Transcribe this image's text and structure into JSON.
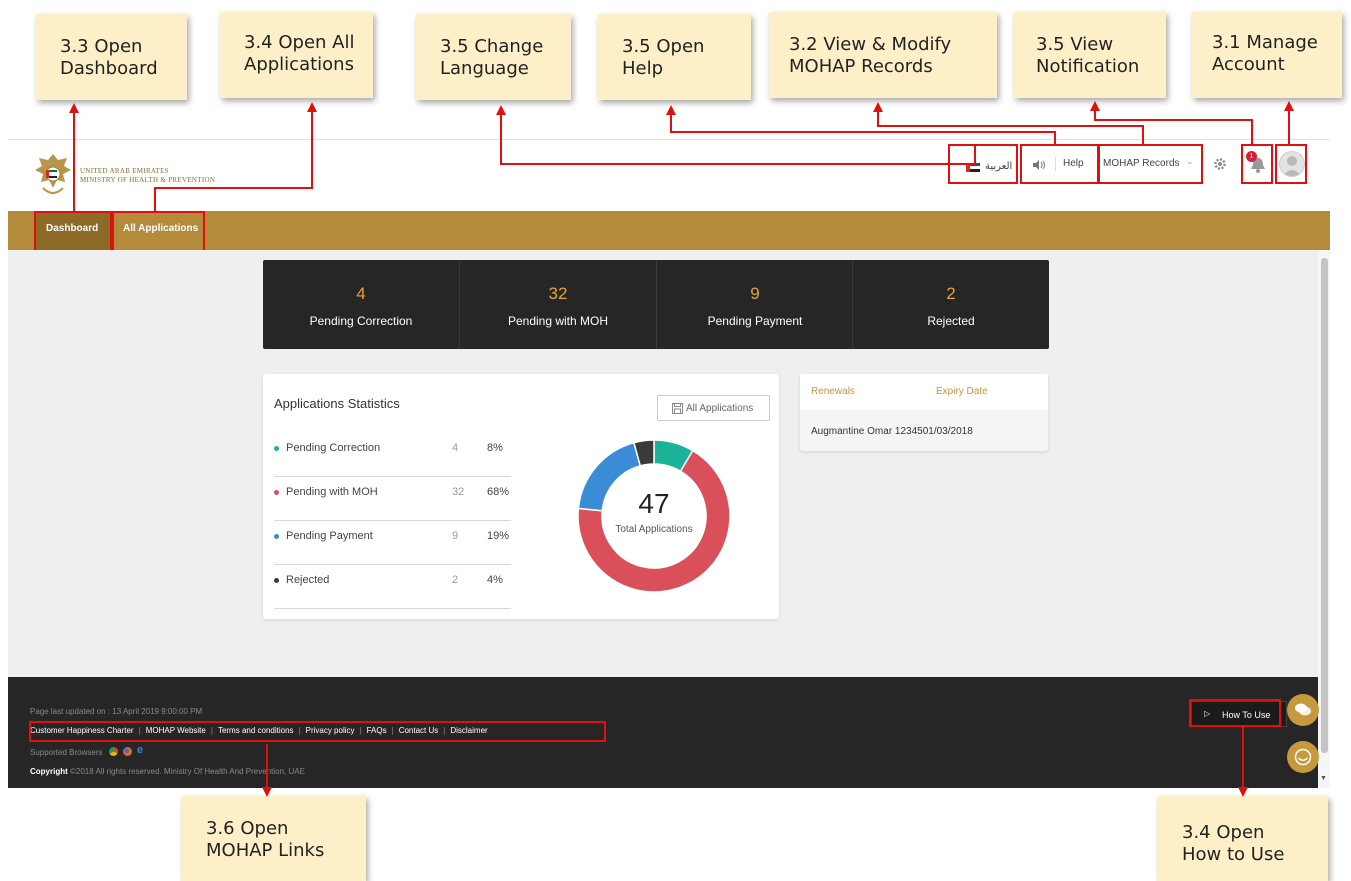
{
  "callouts": [
    {
      "line1": "3.3 Open",
      "line2": "Dashboard"
    },
    {
      "line1": "3.4 Open All",
      "line2": "Applications"
    },
    {
      "line1": "3.5 Change",
      "line2": "Language"
    },
    {
      "line1": "3.5 Open",
      "line2": "Help"
    },
    {
      "line1": "3.2 View & Modify",
      "line2": "MOHAP Records"
    },
    {
      "line1": "3.5 View",
      "line2": "Notification"
    },
    {
      "line1": "3.1 Manage",
      "line2": "Account"
    },
    {
      "line1": "3.6 Open",
      "line2": "MOHAP Links"
    },
    {
      "line1": "3.4 Open",
      "line2": "How to Use"
    }
  ],
  "header": {
    "logo_line1": "UNITED ARAB EMIRATES",
    "logo_line2": "MINISTRY OF HEALTH & PREVENTION",
    "language_label": "العربية",
    "help_label": "Help",
    "records_label": "MOHAP Records",
    "notification_count": "1"
  },
  "nav": {
    "items": [
      "Dashboard",
      "All Applications"
    ]
  },
  "stats": [
    {
      "value": "4",
      "label": "Pending Correction"
    },
    {
      "value": "32",
      "label": "Pending with MOH"
    },
    {
      "value": "9",
      "label": "Pending Payment"
    },
    {
      "value": "2",
      "label": "Rejected"
    }
  ],
  "app_stats": {
    "title": "Applications Statistics",
    "button_label": "All Applications",
    "rows": [
      {
        "label": "Pending Correction",
        "count": "4",
        "pct": "8%",
        "color": "#1ab39a"
      },
      {
        "label": "Pending with MOH",
        "count": "32",
        "pct": "68%",
        "color": "#d9505a"
      },
      {
        "label": "Pending Payment",
        "count": "9",
        "pct": "19%",
        "color": "#3a8cd6"
      },
      {
        "label": "Rejected",
        "count": "2",
        "pct": "4%",
        "color": "#3a3a3a"
      }
    ],
    "total": "47",
    "total_label": "Total Applications"
  },
  "renewals": {
    "col1": "Renewals",
    "col2": "Expiry Date",
    "row": "Augmantine Omar 1234501/03/2018"
  },
  "footer": {
    "updated": "Page last updated on : 13 April 2019 9:00:00 PM",
    "links": [
      "Customer Happiness Charter",
      "MOHAP Website",
      "Terms and conditions",
      "Privacy policy",
      "FAQs",
      "Contact Us",
      "Disclaimer"
    ],
    "browsers_label": "Supported Browsers",
    "copyright_bold": "Copyright",
    "copyright_text": "©2018 All rights reserved. Ministry Of Health And Prevention, UAE",
    "how_to_use": "How To Use"
  }
}
